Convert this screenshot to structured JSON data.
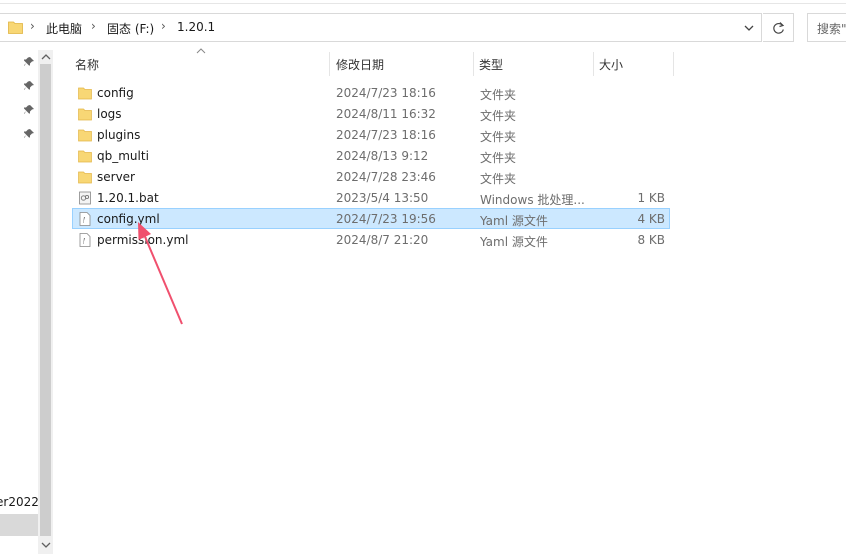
{
  "address_bar": {
    "breadcrumbs": [
      "此电脑",
      "固态 (F:)",
      "1.20.1"
    ],
    "separator": "›",
    "search_placeholder": "搜索\""
  },
  "nav_pane": {
    "partial_item_label": "er2022"
  },
  "columns": {
    "name": "名称",
    "date": "修改日期",
    "type": "类型",
    "size": "大小"
  },
  "files": [
    {
      "name": "config",
      "date": "2024/7/23 18:16",
      "type": "文件夹",
      "size": "",
      "icon": "folder-icon",
      "selected": false
    },
    {
      "name": "logs",
      "date": "2024/8/11 16:32",
      "type": "文件夹",
      "size": "",
      "icon": "folder-icon",
      "selected": false
    },
    {
      "name": "plugins",
      "date": "2024/7/23 18:16",
      "type": "文件夹",
      "size": "",
      "icon": "folder-icon",
      "selected": false
    },
    {
      "name": "qb_multi",
      "date": "2024/8/13 9:12",
      "type": "文件夹",
      "size": "",
      "icon": "folder-icon",
      "selected": false
    },
    {
      "name": "server",
      "date": "2024/7/28 23:46",
      "type": "文件夹",
      "size": "",
      "icon": "folder-icon",
      "selected": false
    },
    {
      "name": "1.20.1.bat",
      "date": "2023/5/4 13:50",
      "type": "Windows 批处理...",
      "size": "1 KB",
      "icon": "batch-file-icon",
      "selected": false
    },
    {
      "name": "config.yml",
      "date": "2024/7/23 19:56",
      "type": "Yaml 源文件",
      "size": "4 KB",
      "icon": "yaml-file-icon",
      "selected": true
    },
    {
      "name": "permission.yml",
      "date": "2024/8/7 21:20",
      "type": "Yaml 源文件",
      "size": "8 KB",
      "icon": "yaml-file-icon",
      "selected": false
    }
  ],
  "colors": {
    "selection_bg": "#cce8ff",
    "selection_border": "#99d1ff",
    "folder_yellow": "#f8d775",
    "annotation_red": "#f0506e"
  }
}
